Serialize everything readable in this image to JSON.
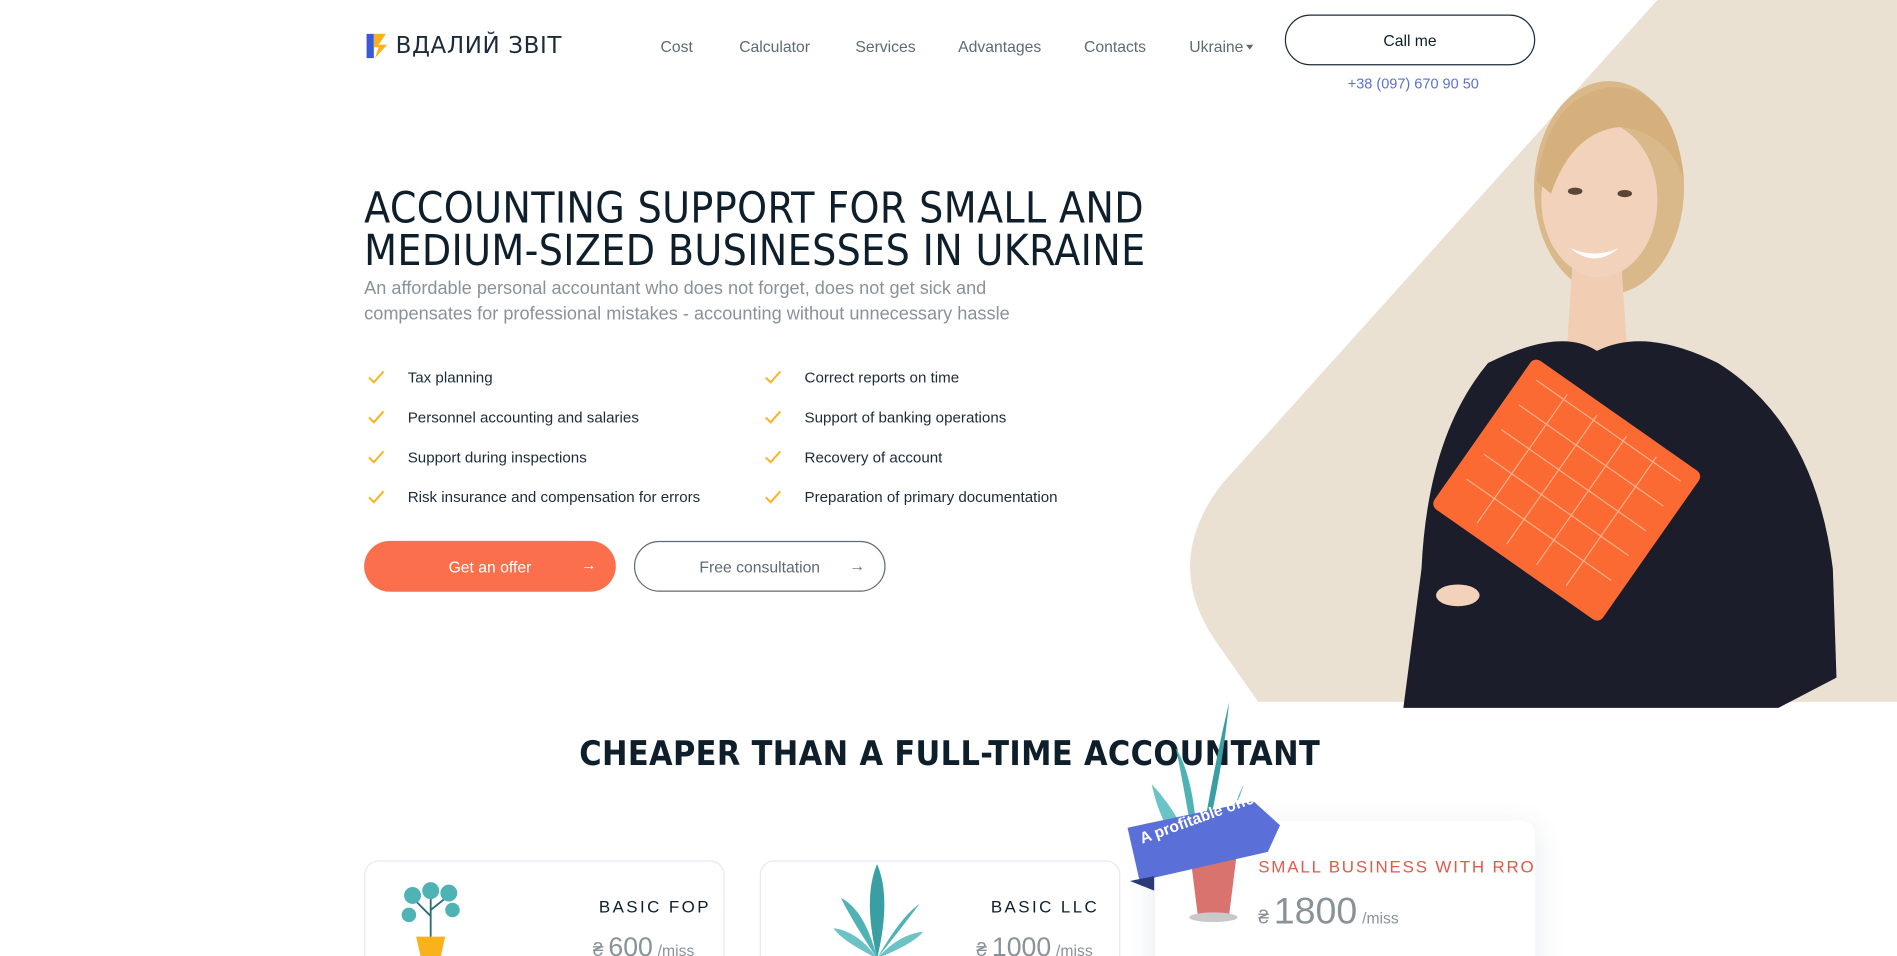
{
  "brand": {
    "name": "ВДАЛИЙ ЗВІТ",
    "accent": "#fc6f4d",
    "link_color": "#5a70d8",
    "hero_bg": "#ebe1d3"
  },
  "nav": {
    "items": [
      "Cost",
      "Calculator",
      "Services",
      "Advantages",
      "Contacts"
    ],
    "language": "Ukraine"
  },
  "header": {
    "call_label": "Call me",
    "phone": "+38 (097) 670 90 50"
  },
  "hero": {
    "title_line1": "ACCOUNTING SUPPORT FOR SMALL AND",
    "title_line2": "MEDIUM-SIZED BUSINESSES IN UKRAINE",
    "subtitle_line1": "An affordable personal accountant who does not forget, does not get sick and",
    "subtitle_line2": "compensates for professional mistakes - accounting without unnecessary hassle",
    "features_left": [
      "Tax planning",
      "Personnel accounting and salaries",
      "Support during inspections",
      "Risk insurance and compensation for errors"
    ],
    "features_right": [
      "Correct reports on time",
      "Support of banking operations",
      "Recovery of account",
      "Preparation of primary documentation"
    ],
    "offer_label": "Get an offer",
    "consult_label": "Free consultation",
    "arrow": "→"
  },
  "pricing": {
    "title": "CHEAPER THAN A FULL-TIME ACCOUNTANT",
    "ribbon": "A profitable offer",
    "currency": "₴",
    "per": "/miss",
    "plans": [
      {
        "name": "BASIC FOP",
        "price": "600"
      },
      {
        "name": "BASIC LLC",
        "price": "1000"
      },
      {
        "name": "SMALL BUSINESS WITH RRO",
        "price": "1800"
      }
    ]
  },
  "icons": [
    "logo-mark-icon",
    "check-icon",
    "arrow-right-icon",
    "caret-down-icon",
    "plant-icon"
  ]
}
